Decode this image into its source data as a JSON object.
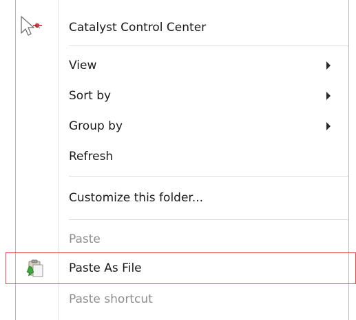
{
  "context_menu": {
    "items": [
      {
        "label": "Catalyst Control Center",
        "icon": "catalyst-control-center-icon",
        "disabled": false,
        "submenu": false
      },
      {
        "label": "View",
        "disabled": false,
        "submenu": true
      },
      {
        "label": "Sort by",
        "disabled": false,
        "submenu": true
      },
      {
        "label": "Group by",
        "disabled": false,
        "submenu": true
      },
      {
        "label": "Refresh",
        "disabled": false,
        "submenu": false
      },
      {
        "label": "Customize this folder...",
        "disabled": false,
        "submenu": false
      },
      {
        "label": "Paste",
        "disabled": true,
        "submenu": false
      },
      {
        "label": "Paste As File",
        "icon": "paste-as-file-icon",
        "disabled": false,
        "submenu": false,
        "highlighted": true
      },
      {
        "label": "Paste shortcut",
        "disabled": true,
        "submenu": false
      }
    ]
  },
  "colors": {
    "highlight_border": "#e34848",
    "disabled_text": "#8d8d8d",
    "text": "#1a1a1a"
  }
}
